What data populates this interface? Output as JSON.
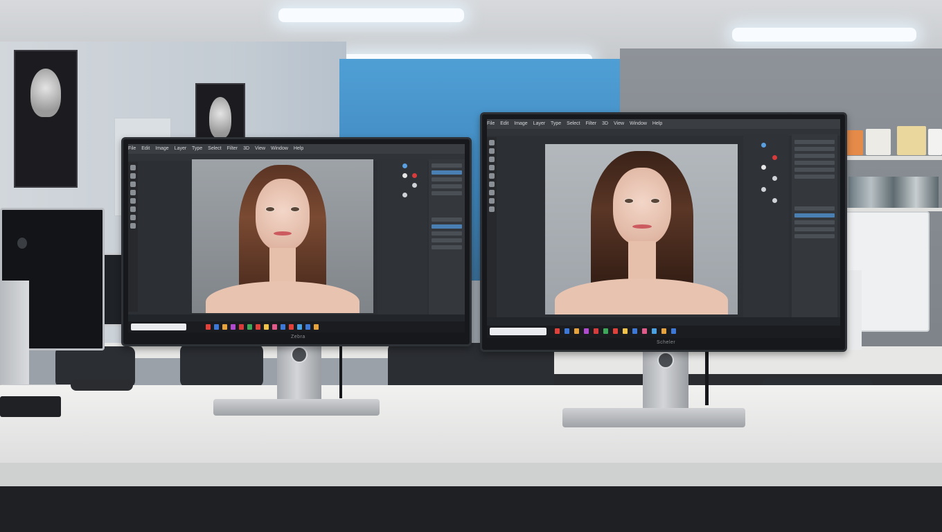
{
  "scene": {
    "description_tags": [
      "office",
      "two-monitors",
      "photo-editing-app"
    ]
  },
  "monitor_left": {
    "brand": "Zebra",
    "menu_items": [
      "File",
      "Edit",
      "Image",
      "Layer",
      "Type",
      "Select",
      "Filter",
      "3D",
      "View",
      "Window",
      "Help"
    ]
  },
  "monitor_right": {
    "brand": "Scheler",
    "menu_items": [
      "File",
      "Edit",
      "Image",
      "Layer",
      "Type",
      "Select",
      "Filter",
      "3D",
      "View",
      "Window",
      "Help"
    ]
  },
  "colors": {
    "accent_red": "#d83b3b",
    "accent_blue": "#4a7fb3"
  }
}
